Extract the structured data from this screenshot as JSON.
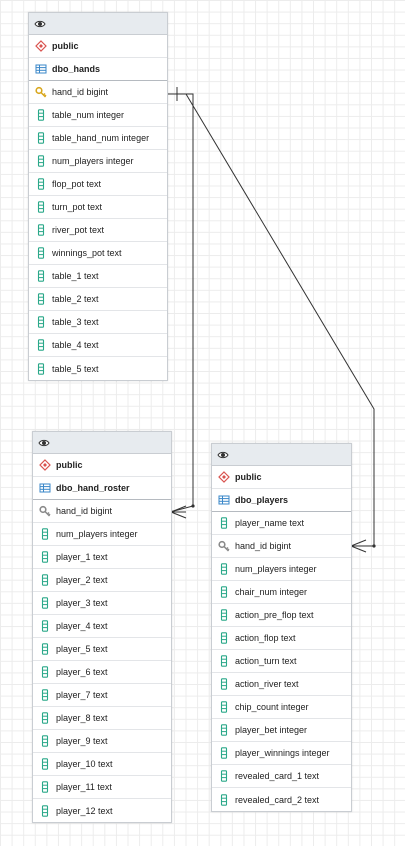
{
  "tables": [
    {
      "schema": "public",
      "name": "dbo_hands",
      "columns": [
        {
          "label": "hand_id bigint",
          "key": "primary"
        },
        {
          "label": "table_num integer",
          "key": "none"
        },
        {
          "label": "table_hand_num integer",
          "key": "none"
        },
        {
          "label": "num_players integer",
          "key": "none"
        },
        {
          "label": "flop_pot text",
          "key": "none"
        },
        {
          "label": "turn_pot text",
          "key": "none"
        },
        {
          "label": "river_pot text",
          "key": "none"
        },
        {
          "label": "winnings_pot text",
          "key": "none"
        },
        {
          "label": "table_1 text",
          "key": "none"
        },
        {
          "label": "table_2 text",
          "key": "none"
        },
        {
          "label": "table_3 text",
          "key": "none"
        },
        {
          "label": "table_4 text",
          "key": "none"
        },
        {
          "label": "table_5 text",
          "key": "none"
        }
      ]
    },
    {
      "schema": "public",
      "name": "dbo_hand_roster",
      "columns": [
        {
          "label": "hand_id bigint",
          "key": "foreign"
        },
        {
          "label": "num_players integer",
          "key": "none"
        },
        {
          "label": "player_1 text",
          "key": "none"
        },
        {
          "label": "player_2 text",
          "key": "none"
        },
        {
          "label": "player_3 text",
          "key": "none"
        },
        {
          "label": "player_4 text",
          "key": "none"
        },
        {
          "label": "player_5 text",
          "key": "none"
        },
        {
          "label": "player_6 text",
          "key": "none"
        },
        {
          "label": "player_7 text",
          "key": "none"
        },
        {
          "label": "player_8 text",
          "key": "none"
        },
        {
          "label": "player_9 text",
          "key": "none"
        },
        {
          "label": "player_10 text",
          "key": "none"
        },
        {
          "label": "player_11 text",
          "key": "none"
        },
        {
          "label": "player_12 text",
          "key": "none"
        }
      ]
    },
    {
      "schema": "public",
      "name": "dbo_players",
      "columns": [
        {
          "label": "player_name text",
          "key": "none"
        },
        {
          "label": "hand_id bigint",
          "key": "foreign"
        },
        {
          "label": "num_players integer",
          "key": "none"
        },
        {
          "label": "chair_num integer",
          "key": "none"
        },
        {
          "label": "action_pre_flop text",
          "key": "none"
        },
        {
          "label": "action_flop text",
          "key": "none"
        },
        {
          "label": "action_turn text",
          "key": "none"
        },
        {
          "label": "action_river text",
          "key": "none"
        },
        {
          "label": "chip_count integer",
          "key": "none"
        },
        {
          "label": "player_bet integer",
          "key": "none"
        },
        {
          "label": "player_winnings integer",
          "key": "none"
        },
        {
          "label": "revealed_card_1 text",
          "key": "none"
        },
        {
          "label": "revealed_card_2 text",
          "key": "none"
        }
      ]
    }
  ],
  "relationships": [
    {
      "from": "dbo_hands.hand_id",
      "to": "dbo_hand_roster.hand_id",
      "type": "one-to-many"
    },
    {
      "from": "dbo_hands.hand_id",
      "to": "dbo_players.hand_id",
      "type": "one-to-many"
    }
  ],
  "icons": {
    "toggle": "eye-icon",
    "schema": "schema-diamond-icon",
    "table": "table-grid-icon",
    "primary_key": "primary-key-icon",
    "foreign_key": "foreign-key-icon",
    "column": "column-icon"
  },
  "colors": {
    "header_bg": "#e7ebef",
    "border": "#c9cdd2",
    "schema_red": "#d9534f",
    "table_blue": "#3a87c8",
    "column_teal": "#2aa889",
    "primary_key_gold": "#d8a71e",
    "foreign_key_gray": "#8a8a8a",
    "link_line": "#333333"
  }
}
